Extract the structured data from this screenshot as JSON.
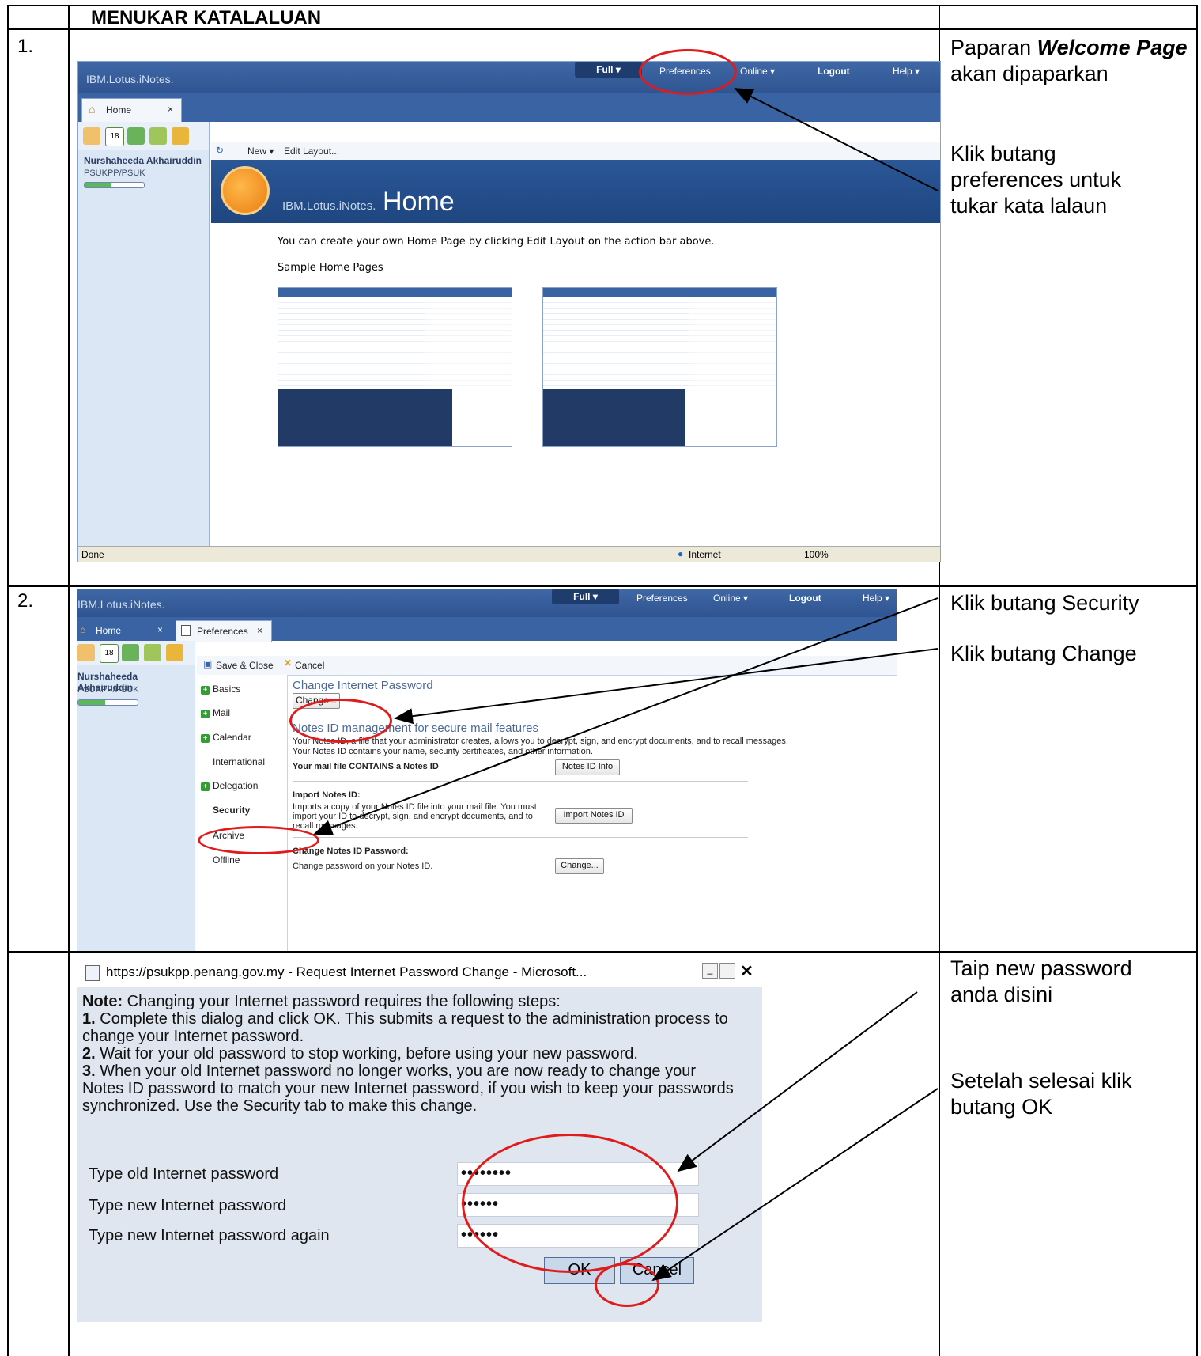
{
  "doc": {
    "heading": "MENUKAR KATALALUAN",
    "step1_number": "1.",
    "step2_number": "2.",
    "step1_notes": {
      "p1_prefix": "Paparan ",
      "p1_bold": "Welcome Page",
      "p1_suffix": " akan dipaparkan",
      "p2": "Klik butang preferences untuk tukar kata lalaun"
    },
    "step2_notes": {
      "p1": "Klik butang Security",
      "p2": "Klik butang Change"
    },
    "step3_notes": {
      "p1": "Taip new password anda disini",
      "p2": "Setelah selesai klik butang OK"
    }
  },
  "shot1": {
    "brand": "IBM.Lotus.iNotes.",
    "nav": {
      "full": "Full ▾",
      "preferences": "Preferences",
      "online": "Online ▾",
      "logout": "Logout",
      "help": "Help ▾"
    },
    "tab_home": "Home",
    "tab_close": "×",
    "user_name": "Nurshaheeda Akhairuddin",
    "user_org": "PSUKPP/PSUK",
    "action_new": "New ▾",
    "action_edit_layout": "Edit Layout...",
    "banner_brand": "IBM.Lotus.iNotes.",
    "banner_title": "Home",
    "body_line": "You can create your own Home Page by clicking Edit Layout on the action bar above.",
    "sample_label": "Sample Home Pages",
    "status_done": "Done",
    "status_zone": "Internet",
    "status_zoom": "100%",
    "calendar_day": "18"
  },
  "shot2": {
    "brand": "IBM.Lotus.iNotes.",
    "nav": {
      "full": "Full ▾",
      "preferences": "Preferences",
      "online": "Online ▾",
      "logout": "Logout",
      "help": "Help ▾"
    },
    "tab_home": "Home",
    "tab_prefs": "Preferences",
    "tab_close": "×",
    "user_name": "Nurshaheeda Akhairuddin",
    "user_org": "PSUKPP/PSUK",
    "calendar_day": "18",
    "save_close": "Save & Close",
    "cancel": "Cancel",
    "nav_items": {
      "basics": "Basics",
      "mail": "Mail",
      "calendar": "Calendar",
      "international": "International",
      "delegation": "Delegation",
      "security": "Security",
      "archive": "Archive",
      "offline": "Offline"
    },
    "change_internet_password": "Change Internet Password",
    "change_btn": "Change...",
    "notes_id_heading": "Notes ID management for secure mail features",
    "notes_id_desc": "Your Notes ID, a file that your administrator creates, allows you to decrypt, sign, and encrypt documents, and to recall messages. Your Notes ID contains your name, security certificates, and other information.",
    "contains_id": "Your mail file CONTAINS a Notes ID",
    "notes_id_info_btn": "Notes ID Info",
    "import_heading": "Import Notes ID:",
    "import_desc": "Imports a copy of your Notes ID file into your mail file. You must import your ID to decrypt, sign, and encrypt documents, and to recall messages.",
    "import_btn": "Import Notes ID",
    "change_id_pw_heading": "Change Notes ID Password:",
    "change_id_pw_desc": "Change password on your Notes ID.",
    "change_id_pw_btn": "Change..."
  },
  "dialog": {
    "title": "https://psukpp.penang.gov.my - Request Internet Password Change - Microsoft...",
    "note_label": "Note:",
    "note_text": " Changing your Internet password requires the following steps:",
    "step1_num": "1.",
    "step1_text": " Complete this dialog and click OK. This submits a request to the administration process to change your Internet password.",
    "step2_num": "2.",
    "step2_text": " Wait for your old password to stop working, before using your new password.",
    "step3_num": "3.",
    "step3_text": " When your old Internet password no longer works, you are now ready to change your Notes ID password to match your new Internet password, if you wish to keep your passwords synchronized. Use the Security tab to make this change.",
    "label_old": "Type old Internet password",
    "label_new": "Type new Internet password",
    "label_again": "Type new Internet password again",
    "value_old": "••••••••",
    "value_new": "••••••",
    "value_again": "••••••",
    "ok": "OK",
    "cancel": "Cancel"
  },
  "colors": {
    "annotation_red": "#e01b1b",
    "lotus_blue": "#2f5491"
  }
}
